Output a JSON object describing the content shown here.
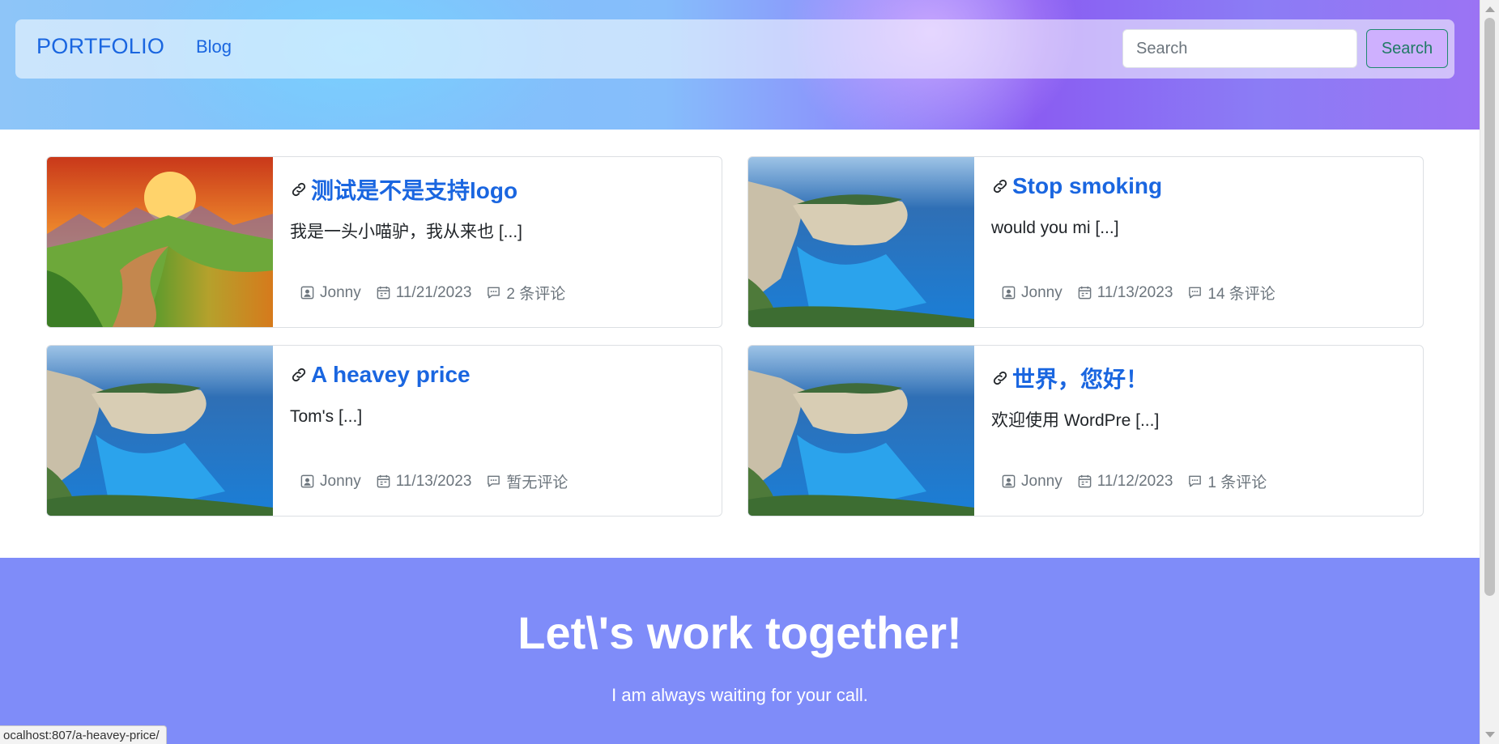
{
  "navbar": {
    "brand": "PORTFOLIO",
    "links": [
      "Blog"
    ],
    "search": {
      "placeholder": "Search",
      "value": "",
      "button_label": "Search"
    }
  },
  "posts": [
    {
      "title": "测试是不是支持logo",
      "excerpt": "我是一头小喵驴，我从来也 [...]",
      "author": "Jonny",
      "date": "11/21/2023",
      "comments": "2 条评论",
      "image": "landscape-sunset"
    },
    {
      "title": "Stop smoking",
      "excerpt": "would you mi [...]",
      "author": "Jonny",
      "date": "11/13/2023",
      "comments": "14 条评论",
      "image": "coastal-cove"
    },
    {
      "title": "A heavey price",
      "excerpt": "Tom's [...]",
      "author": "Jonny",
      "date": "11/13/2023",
      "comments": "暂无评论",
      "image": "coastal-cove"
    },
    {
      "title": "世界，您好！",
      "excerpt": "欢迎使用 WordPre [...]",
      "author": "Jonny",
      "date": "11/12/2023",
      "comments": "1 条评论",
      "image": "coastal-cove"
    }
  ],
  "cta": {
    "title": "Let\\'s work together!",
    "text": "I am always waiting for your call."
  },
  "statusbar": {
    "url": "ocalhost:807/a-heavey-price/"
  },
  "colors": {
    "link_blue": "#1a66e0",
    "cta_background": "#7f8cf9",
    "search_button_border": "#1f8a70"
  }
}
